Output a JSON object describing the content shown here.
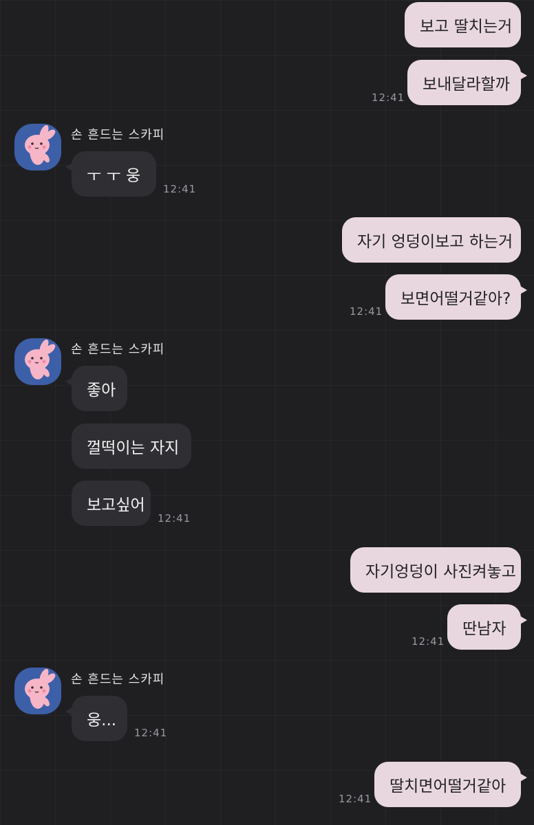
{
  "colors": {
    "background": "#1f1f22",
    "outgoing_bubble": "#e9d7df",
    "incoming_bubble": "#2f2f33",
    "avatar_bg": "#3d5fa8",
    "time_text": "#9a9aa0"
  },
  "chat": {
    "sender_name": "손 흔드는 스카피",
    "avatar_icon": "pink-rabbit-icon",
    "messages": [
      {
        "direction": "out",
        "text": "보고 딸치는거"
      },
      {
        "direction": "out",
        "text": "보내달라할까",
        "time": "12:41"
      },
      {
        "direction": "in",
        "text": "ㅜ ㅜ 웅",
        "time": "12:41"
      },
      {
        "direction": "out",
        "text": "자기 엉덩이보고 하는거"
      },
      {
        "direction": "out",
        "text": "보면어떨거같아?",
        "time": "12:41"
      },
      {
        "direction": "in",
        "text": "좋아"
      },
      {
        "direction": "in",
        "text": "껄떡이는 자지"
      },
      {
        "direction": "in",
        "text": "보고싶어",
        "time": "12:41"
      },
      {
        "direction": "out",
        "text": "자기엉덩이 사진켜놓고"
      },
      {
        "direction": "out",
        "text": "딴남자",
        "time": "12:41"
      },
      {
        "direction": "in",
        "text": "웅...",
        "time": "12:41"
      },
      {
        "direction": "out",
        "text": "딸치면어떨거같아",
        "time": "12:41"
      }
    ]
  }
}
